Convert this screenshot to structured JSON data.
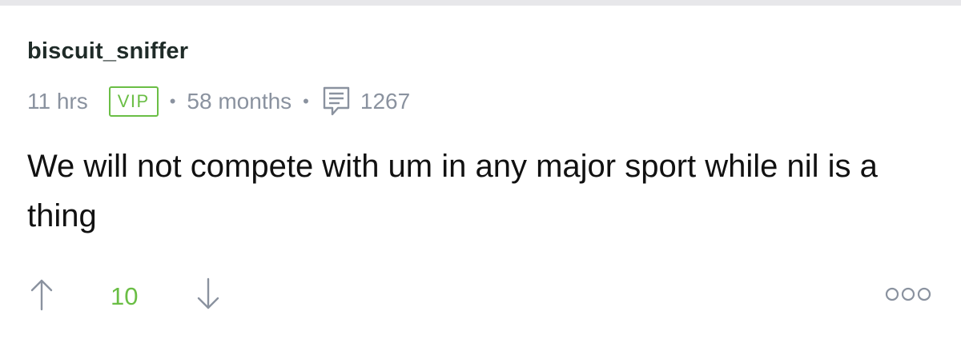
{
  "comment": {
    "author": "biscuit_sniffer",
    "posted_ago": "11 hrs",
    "badge": "VIP",
    "separator": "•",
    "membership": "58 months",
    "post_count": "1267",
    "text": "We will not compete with um in any major sport while nil is a thing",
    "score": "10"
  },
  "colors": {
    "accent": "#6abe45",
    "meta": "#8a929f",
    "username": "#1f2b28",
    "text": "#111111"
  },
  "icons": {
    "comment": "comment-bubble-icon",
    "upvote": "arrow-up-icon",
    "downvote": "arrow-down-icon",
    "more": "more-options-icon"
  }
}
